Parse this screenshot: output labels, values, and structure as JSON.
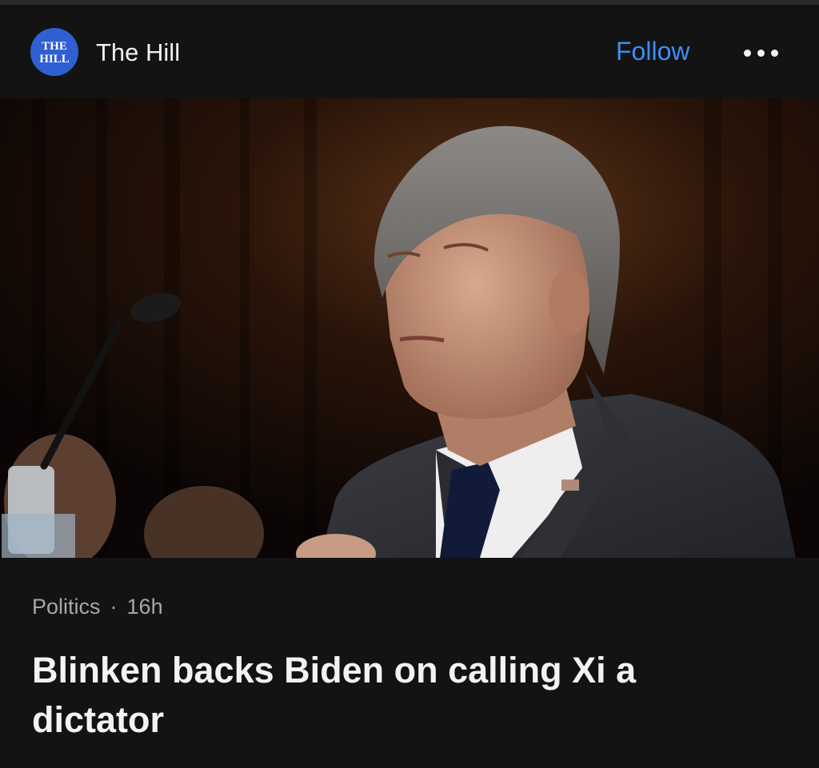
{
  "header": {
    "logo_text_top": "THE",
    "logo_text_bottom": "HILL",
    "source_name": "The Hill",
    "follow_label": "Follow",
    "more_icon": "ellipsis-icon"
  },
  "hero": {
    "image": "photo-speaker-at-microphone"
  },
  "article": {
    "category": "Politics",
    "separator": "·",
    "age": "16h",
    "headline": "Blinken backs Biden on calling Xi a dictator"
  },
  "colors": {
    "background": "#131313",
    "accent": "#3e8ef5",
    "logo": "#2f5fd2"
  }
}
